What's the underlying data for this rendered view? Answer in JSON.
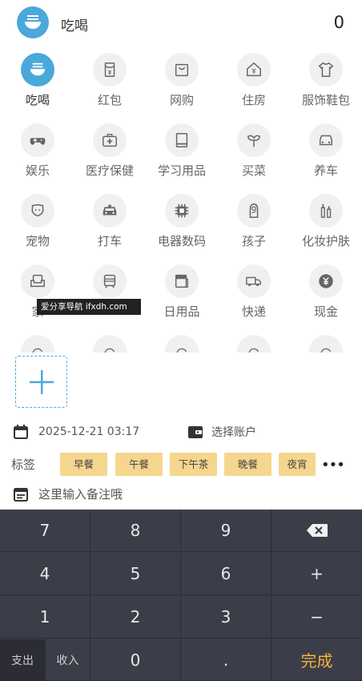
{
  "header": {
    "title": "吃喝",
    "amount": "0",
    "icon": "bowl-icon"
  },
  "categories": [
    {
      "label": "吃喝",
      "icon": "bowl-icon",
      "active": true
    },
    {
      "label": "红包",
      "icon": "red-packet-icon"
    },
    {
      "label": "网购",
      "icon": "shopping-bag-icon"
    },
    {
      "label": "住房",
      "icon": "house-icon"
    },
    {
      "label": "服饰鞋包",
      "icon": "shirt-icon"
    },
    {
      "label": "娱乐",
      "icon": "gamepad-icon"
    },
    {
      "label": "医疗保健",
      "icon": "medical-kit-icon"
    },
    {
      "label": "学习用品",
      "icon": "book-icon"
    },
    {
      "label": "买菜",
      "icon": "vegetable-icon"
    },
    {
      "label": "养车",
      "icon": "car-icon"
    },
    {
      "label": "宠物",
      "icon": "pet-icon"
    },
    {
      "label": "打车",
      "icon": "taxi-icon"
    },
    {
      "label": "电器数码",
      "icon": "chip-icon"
    },
    {
      "label": "孩子",
      "icon": "baby-icon"
    },
    {
      "label": "化妆护肤",
      "icon": "cosmetics-icon"
    },
    {
      "label": "家",
      "icon": "sofa-icon"
    },
    {
      "label": "",
      "icon": "bus-icon"
    },
    {
      "label": "日用品",
      "icon": "daily-goods-icon"
    },
    {
      "label": "快递",
      "icon": "truck-icon"
    },
    {
      "label": "现金",
      "icon": "yen-coin-icon"
    }
  ],
  "watermark": "爱分享导航 ifxdh.com",
  "date": "2025-12-21 03:17",
  "account": "选择账户",
  "tags_label": "标签",
  "tags": [
    "早餐",
    "午餐",
    "下午茶",
    "晚餐",
    "夜宵"
  ],
  "more": "•••",
  "note_placeholder": "这里输入备注哦",
  "keypad": {
    "row1": [
      "7",
      "8",
      "9"
    ],
    "row2": [
      "4",
      "5",
      "6",
      "+"
    ],
    "row3": [
      "1",
      "2",
      "3",
      "−"
    ],
    "expense": "支出",
    "income": "收入",
    "zero": "0",
    "dot": ".",
    "done": "完成"
  },
  "colors": {
    "accent": "#4aa8db",
    "tag_bg": "#f6d68e",
    "keypad_bg": "#3b3d48",
    "done": "#f2b43a"
  }
}
